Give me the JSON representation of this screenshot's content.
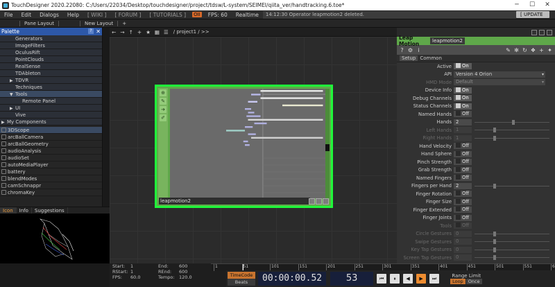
{
  "window": {
    "title": "TouchDesigner 2020.22080: C:/Users/22034/Desktop/touchdesigner/project/tdsw/L-system/SEIMEI/qiita_ver/handtracking.6.toe*",
    "min": "─",
    "max": "☐",
    "close": "✕"
  },
  "menu": {
    "file": "File",
    "edit": "Edit",
    "dialogs": "Dialogs",
    "help": "Help",
    "wiki": "[ WIKI ]",
    "forum": "[ FORUM ]",
    "tutorials": "[ TUTORIALS ]",
    "oii": "OII",
    "fps": "FPS:  60",
    "realtime": "Realtime",
    "message": "14:12:30 Operator leapmotion2 deleted.",
    "update": "[ UPDATE ]"
  },
  "layout_bar": {
    "pane_layout": "Pane Layout",
    "new_layout": "New Layout",
    "add": "+"
  },
  "palette": {
    "title": "Palette",
    "help": "?",
    "close": "✕",
    "items": [
      {
        "label": "Generators",
        "level": 1
      },
      {
        "label": "ImageFilters",
        "level": 1
      },
      {
        "label": "OculusRift",
        "level": 1
      },
      {
        "label": "PointClouds",
        "level": 1
      },
      {
        "label": "RealSense",
        "level": 1
      },
      {
        "label": "TDAbleton",
        "level": 1
      },
      {
        "label": "TDVR",
        "level": 1,
        "arrow": "▶"
      },
      {
        "label": "Techniques",
        "level": 1
      },
      {
        "label": "Tools",
        "level": 1,
        "arrow": "▼",
        "selected": true
      },
      {
        "label": "Remote Panel",
        "level": 2
      },
      {
        "label": "UI",
        "level": 1,
        "arrow": "▶"
      },
      {
        "label": "Vive",
        "level": 1
      },
      {
        "label": "My Components",
        "level": 0,
        "arrow": "▶"
      }
    ],
    "components": [
      "3DScope",
      "arcBallCamera",
      "arcBallGeometry",
      "audioAnalysis",
      "audioSet",
      "autoMediaPlayer",
      "battery",
      "blendModes",
      "camSchnappr",
      "chromaKey"
    ]
  },
  "viewer_tabs": {
    "icon": "Icon",
    "info": "Info",
    "suggestions": "Suggestions"
  },
  "stats": {
    "start_label": "Start:",
    "start": "1",
    "end_label": "End:",
    "end": "600",
    "rstart_label": "RStart:",
    "rstart": "1",
    "rend_label": "REnd:",
    "rend": "600",
    "fps_label": "FPS:",
    "fps": "60.0",
    "tempo_label": "Tempo:",
    "tempo": "120.0"
  },
  "network": {
    "path": "/ project1 / >>",
    "node_name": "leapmotion2",
    "node_icons": [
      "⊕",
      "✎",
      "➔",
      "✐"
    ]
  },
  "chart_data": {
    "type": "bar",
    "title": "",
    "note": "leapmotion2 channel trail viewer (horizontal bars per channel)",
    "bars": [
      {
        "row": 0,
        "start": 0.58,
        "end": 0.98,
        "color": "#e8e8e8"
      },
      {
        "row": 1,
        "start": 0.52,
        "end": 0.58,
        "color": "#b8b8e8"
      },
      {
        "row": 2,
        "start": 0.58,
        "end": 0.98,
        "color": "#e8e8e8"
      },
      {
        "row": 3,
        "start": 0.5,
        "end": 0.56,
        "color": "#c8c8f0"
      },
      {
        "row": 4,
        "start": 0.72,
        "end": 0.98,
        "color": "#e8e8d0"
      },
      {
        "row": 5,
        "start": 0.48,
        "end": 0.52,
        "color": "#b0b0e0"
      },
      {
        "row": 6,
        "start": 0.5,
        "end": 0.54,
        "color": "#b0b0e0"
      },
      {
        "row": 7,
        "start": 0.49,
        "end": 0.58,
        "color": "#b0b0e0"
      },
      {
        "row": 8,
        "start": 0.5,
        "end": 0.98,
        "color": "#d8d8d8"
      },
      {
        "row": 9,
        "start": 0.54,
        "end": 0.62,
        "color": "#b0b0e0"
      },
      {
        "row": 10,
        "start": 0.48,
        "end": 0.53,
        "color": "#b0b0e0"
      },
      {
        "row": 11,
        "start": 0.36,
        "end": 0.48,
        "color": "#a0d0c8"
      },
      {
        "row": 12,
        "start": 0.5,
        "end": 0.55,
        "color": "#b0b0e0"
      },
      {
        "row": 13,
        "start": 0.52,
        "end": 0.98,
        "color": "#d0d0d0"
      },
      {
        "row": 14,
        "start": 0.47,
        "end": 0.5,
        "color": "#b0b0e0"
      },
      {
        "row": 15,
        "start": 0.48,
        "end": 0.51,
        "color": "#b0b0e0"
      }
    ],
    "guide_x": 0.595
  },
  "params": {
    "op_type": "Leap Motion",
    "op_name": "leapmotion2",
    "tabs": [
      "Setup",
      "Common"
    ],
    "rows": [
      {
        "label": "Active",
        "kind": "toggle",
        "value": "On",
        "on": true
      },
      {
        "label": "API",
        "kind": "menu",
        "value": "Version 4 Orion"
      },
      {
        "label": "HMD Mode",
        "kind": "menu",
        "value": "Default",
        "dim": true
      },
      {
        "label": "Device Info",
        "kind": "toggle",
        "value": "On",
        "on": true
      },
      {
        "label": "Debug Channels",
        "kind": "toggle",
        "value": "On",
        "on": true
      },
      {
        "label": "Status Channels",
        "kind": "toggle",
        "value": "On",
        "on": true
      },
      {
        "label": "Named Hands",
        "kind": "toggle",
        "value": "Off"
      },
      {
        "label": "Hands",
        "kind": "num",
        "value": "2",
        "slider": 0.5
      },
      {
        "label": "Left Hands",
        "kind": "num",
        "value": "1",
        "dim": true,
        "slider": 0.25
      },
      {
        "label": "Right Hands",
        "kind": "num",
        "value": "1",
        "dim": true,
        "slider": 0.25
      },
      {
        "label": "Hand Velocity",
        "kind": "toggle",
        "value": "Off"
      },
      {
        "label": "Hand Sphere",
        "kind": "toggle",
        "value": "Off"
      },
      {
        "label": "Pinch Strength",
        "kind": "toggle",
        "value": "Off"
      },
      {
        "label": "Grab Strength",
        "kind": "toggle",
        "value": "Off"
      },
      {
        "label": "Named Fingers",
        "kind": "toggle",
        "value": "Off"
      },
      {
        "label": "Fingers per Hand",
        "kind": "num",
        "value": "2",
        "slider": 0.25
      },
      {
        "label": "Finger Rotation",
        "kind": "toggle",
        "value": "Off"
      },
      {
        "label": "Finger Size",
        "kind": "toggle",
        "value": "Off"
      },
      {
        "label": "Finger Extended",
        "kind": "toggle",
        "value": "Off"
      },
      {
        "label": "Finger Joints",
        "kind": "toggle",
        "value": "Off"
      },
      {
        "label": "Tools",
        "kind": "toggle",
        "value": "Off",
        "dim": true
      },
      {
        "label": "Circle Gestures",
        "kind": "num",
        "value": "0",
        "dim": true,
        "slider": 0.25
      },
      {
        "label": "Swipe Gestures",
        "kind": "num",
        "value": "0",
        "dim": true,
        "slider": 0.25
      },
      {
        "label": "Key Tap Gestures",
        "kind": "num",
        "value": "0",
        "dim": true,
        "slider": 0.25
      },
      {
        "label": "Screen Tap Gestures",
        "kind": "num",
        "value": "0",
        "dim": true,
        "slider": 0.25
      }
    ]
  },
  "timeline": {
    "ticks": [
      "1",
      "51",
      "101",
      "151",
      "201",
      "251",
      "301",
      "351",
      "401",
      "451",
      "501",
      "551",
      "600"
    ],
    "timecode_label": "TimeCode",
    "beats_label": "Beats",
    "timecode": "00:00:00.52",
    "frame": "53",
    "range_label": "Range Limit",
    "loop": "Loop",
    "once": "Once",
    "controls": [
      "⏮",
      "⏸",
      "◀",
      "▶",
      "⏭"
    ]
  }
}
